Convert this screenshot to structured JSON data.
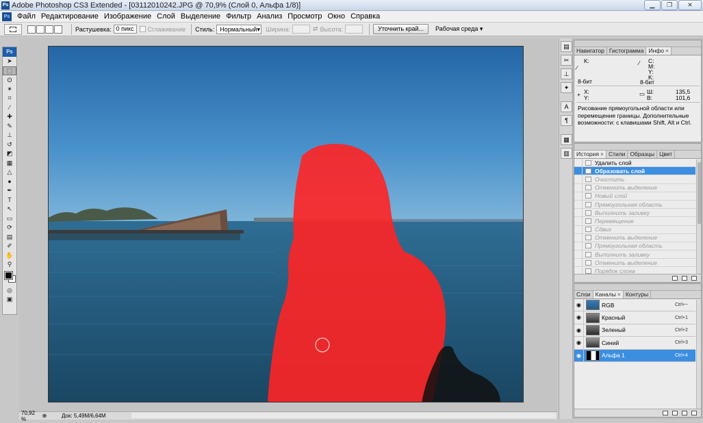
{
  "window": {
    "app_icon": "Ps",
    "title": "Adobe Photoshop CS3 Extended - [03112010242.JPG @ 70,9% (Слой 0, Альфа 1/8)]",
    "minimize_glyph": "▁",
    "maximize_glyph": "❐",
    "close_glyph": "✕"
  },
  "menu": {
    "logo": "Ps",
    "items": [
      "Файл",
      "Редактирование",
      "Изображение",
      "Слой",
      "Выделение",
      "Фильтр",
      "Анализ",
      "Просмотр",
      "Окно",
      "Справка"
    ]
  },
  "options": {
    "feather_label": "Растушевка:",
    "feather_value": "0 пикс",
    "antialias_label": "Сглаживание",
    "style_label": "Стиль:",
    "style_value": "Нормальный",
    "width_label": "Ширина:",
    "swap_icon": "⇄",
    "height_label": "Высота:",
    "refine_button": "Уточнить край...",
    "workspace_label": "Рабочая среда ▾"
  },
  "toolbox": {
    "logo": "Ps",
    "tools": [
      {
        "name": "move-tool-icon",
        "glyph": "➤"
      },
      {
        "name": "rect-marquee-tool-icon",
        "glyph": "⬚"
      },
      {
        "name": "lasso-tool-icon",
        "glyph": "ʘ"
      },
      {
        "name": "magic-wand-tool-icon",
        "glyph": "✶"
      },
      {
        "name": "crop-tool-icon",
        "glyph": "⌗"
      },
      {
        "name": "eyedropper-tool-icon",
        "glyph": "⁄"
      },
      {
        "name": "healing-brush-tool-icon",
        "glyph": "✚"
      },
      {
        "name": "brush-tool-icon",
        "glyph": "✎"
      },
      {
        "name": "clone-stamp-tool-icon",
        "glyph": "⊥"
      },
      {
        "name": "history-brush-tool-icon",
        "glyph": "↺"
      },
      {
        "name": "eraser-tool-icon",
        "glyph": "◩"
      },
      {
        "name": "gradient-tool-icon",
        "glyph": "▦"
      },
      {
        "name": "blur-tool-icon",
        "glyph": "△"
      },
      {
        "name": "dodge-tool-icon",
        "glyph": "●"
      },
      {
        "name": "pen-tool-icon",
        "glyph": "✒"
      },
      {
        "name": "type-tool-icon",
        "glyph": "T"
      },
      {
        "name": "path-selection-tool-icon",
        "glyph": "↖"
      },
      {
        "name": "shape-tool-icon",
        "glyph": "▭"
      },
      {
        "name": "3d-rotate-tool-icon",
        "glyph": "⟳"
      },
      {
        "name": "notes-tool-icon",
        "glyph": "▤"
      },
      {
        "name": "eyedropper2-tool-icon",
        "glyph": "✐"
      },
      {
        "name": "hand-tool-icon",
        "glyph": "✋"
      },
      {
        "name": "zoom-tool-icon",
        "glyph": "⚲"
      }
    ],
    "quickmask": "◎",
    "screenmode": "▣"
  },
  "status": {
    "zoom": "70,92 %",
    "zoom_icon": "⊕",
    "doc_info": "Док: 5,49M/6,64M",
    "arrow": "▶"
  },
  "dock_icons": [
    {
      "name": "navigator-dock-icon",
      "glyph": "▤"
    },
    {
      "name": "tools-dock-icon",
      "glyph": "✂"
    },
    {
      "name": "stamp-dock-icon",
      "glyph": "⊥"
    },
    {
      "name": "color-dock-icon",
      "glyph": "✦"
    },
    {
      "name": "type-dock-icon",
      "glyph": "A"
    },
    {
      "name": "paragraph-dock-icon",
      "glyph": "¶"
    },
    {
      "name": "layers-dock-icon",
      "glyph": "▦"
    },
    {
      "name": "channels-dock-icon",
      "glyph": "▥"
    }
  ],
  "info_panel": {
    "tabs": [
      "Навигатор",
      "Гистограмма",
      "Инфо"
    ],
    "active_tab": "Инфо",
    "tab_close": "×",
    "k_label": "K:",
    "c_label": "C:",
    "m_label": "M:",
    "y_label": "Y:",
    "k2_label": "K:",
    "bits_left": "8-бит",
    "bits_right": "8-бит",
    "x_label": "X:",
    "y2_label": "Y:",
    "w_label": "Ш:",
    "w_value": "135,5",
    "h_label": "В:",
    "h_value": "101,6",
    "hint": "Рисование прямоугольной области или перемещение границы. Дополнительные возможности: с клавишами Shift, Alt и Ctrl."
  },
  "history_panel": {
    "tabs": [
      "История",
      "Стили",
      "Образцы",
      "Цвет"
    ],
    "active_tab": "История",
    "items": [
      {
        "label": "Удалить слой",
        "state": "normal"
      },
      {
        "label": "Образовать слой",
        "state": "current"
      },
      {
        "label": "Очистить",
        "state": "disabled"
      },
      {
        "label": "Отменить выделение",
        "state": "disabled"
      },
      {
        "label": "Новый слой",
        "state": "disabled"
      },
      {
        "label": "Прямоугольная область",
        "state": "disabled"
      },
      {
        "label": "Выполнить заливку",
        "state": "disabled"
      },
      {
        "label": "Перемещение",
        "state": "disabled"
      },
      {
        "label": "Сдвиг",
        "state": "disabled"
      },
      {
        "label": "Отменить выделение",
        "state": "disabled"
      },
      {
        "label": "Прямоугольная область",
        "state": "disabled"
      },
      {
        "label": "Выполнить заливку",
        "state": "disabled"
      },
      {
        "label": "Отменить выделение",
        "state": "disabled"
      },
      {
        "label": "Порядок слоев",
        "state": "disabled"
      }
    ]
  },
  "channels_panel": {
    "tabs": [
      "Слои",
      "Каналы",
      "Контуры"
    ],
    "active_tab": "Каналы",
    "eye": "👁",
    "channels": [
      {
        "name": "RGB",
        "key": "Ctrl+~",
        "selected": false
      },
      {
        "name": "Красный",
        "key": "Ctrl+1",
        "selected": false
      },
      {
        "name": "Зеленый",
        "key": "Ctrl+2",
        "selected": false
      },
      {
        "name": "Синий",
        "key": "Ctrl+3",
        "selected": false
      },
      {
        "name": "Альфа 1",
        "key": "Ctrl+4",
        "selected": true
      }
    ]
  },
  "colors": {
    "selection_highlight": "#3c8ee0",
    "quickmask_overlay": "#ff2020",
    "sky_top": "#2d6fa8",
    "sea": "#1f4e6e"
  }
}
